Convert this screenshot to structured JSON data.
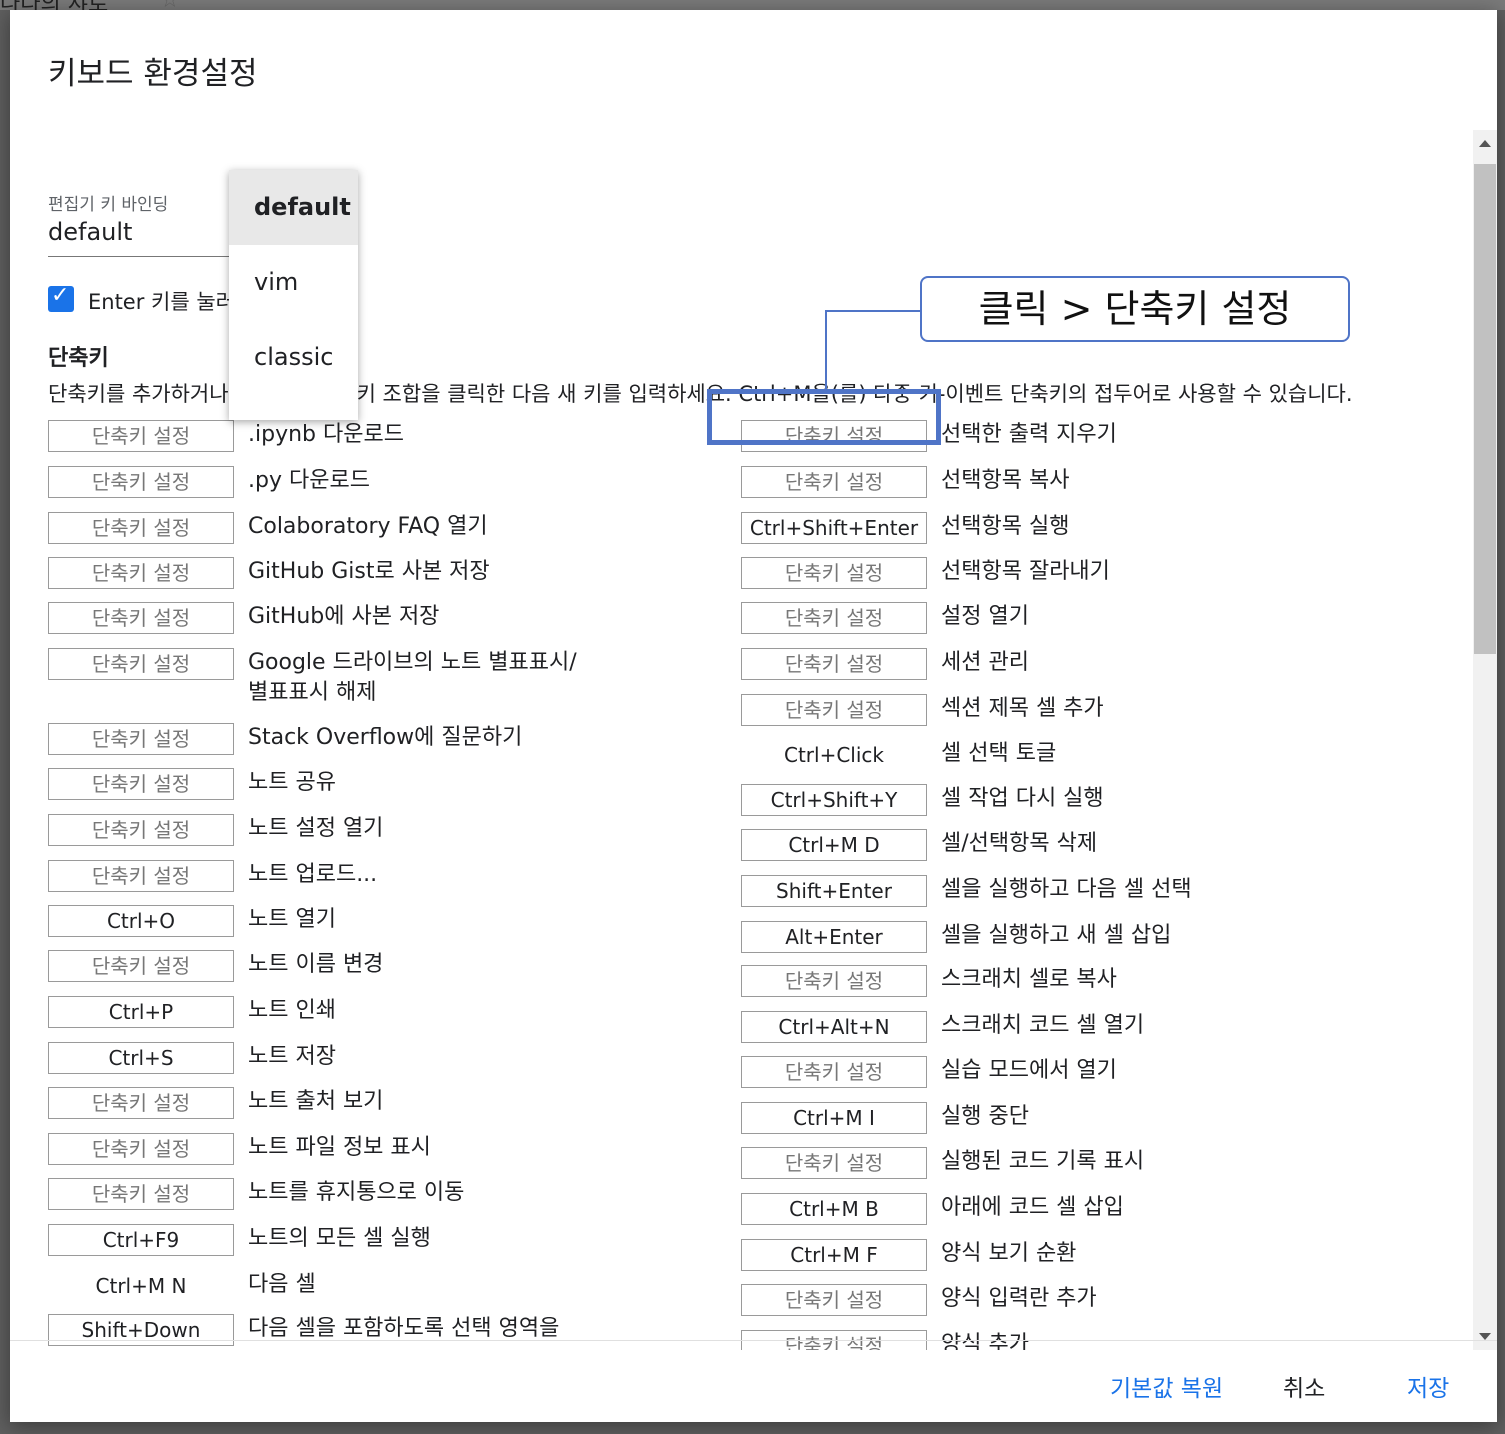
{
  "background": {
    "title": "나다의 샤로",
    "star_icon": "star-icon"
  },
  "dialog": {
    "title": "키보드 환경설정",
    "binding_label": "편집기 키 바인딩",
    "binding_value": "default",
    "binding_options": [
      "default",
      "vim",
      "classic"
    ],
    "enter_checkbox": {
      "checked": true,
      "label": "Enter 키를 눌러"
    },
    "shortcuts_heading": "단축키",
    "shortcuts_desc_prefix": "단축키를 추가하거나",
    "shortcuts_desc_suffix": "키 조합을 클릭한 다음 새 키를 입력하세요. Ctrl+M을(를) 다중 키-이벤트 단축키의 접두어로 사용할 수 있습니다.",
    "left_shortcuts": [
      {
        "key": "단축키 설정",
        "unset": true,
        "label": ".ipynb 다운로드"
      },
      {
        "key": "단축키 설정",
        "unset": true,
        "label": ".py 다운로드"
      },
      {
        "key": "단축키 설정",
        "unset": true,
        "label": "Colaboratory FAQ 열기"
      },
      {
        "key": "단축키 설정",
        "unset": true,
        "label": "GitHub Gist로 사본 저장"
      },
      {
        "key": "단축키 설정",
        "unset": true,
        "label": "GitHub에 사본 저장"
      },
      {
        "key": "단축키 설정",
        "unset": true,
        "label": "Google 드라이브의 노트 별표표시/",
        "label2": "별표표시 해제"
      },
      {
        "key": "단축키 설정",
        "unset": true,
        "label": "Stack Overflow에 질문하기"
      },
      {
        "key": "단축키 설정",
        "unset": true,
        "label": "노트 공유"
      },
      {
        "key": "단축키 설정",
        "unset": true,
        "label": "노트 설정 열기"
      },
      {
        "key": "단축키 설정",
        "unset": true,
        "label": "노트 업로드..."
      },
      {
        "key": "Ctrl+O",
        "unset": false,
        "label": "노트 열기"
      },
      {
        "key": "단축키 설정",
        "unset": true,
        "label": "노트 이름 변경"
      },
      {
        "key": "Ctrl+P",
        "unset": false,
        "label": "노트 인쇄"
      },
      {
        "key": "Ctrl+S",
        "unset": false,
        "label": "노트 저장"
      },
      {
        "key": "단축키 설정",
        "unset": true,
        "label": "노트 출처 보기"
      },
      {
        "key": "단축키 설정",
        "unset": true,
        "label": "노트 파일 정보 표시"
      },
      {
        "key": "단축키 설정",
        "unset": true,
        "label": "노트를 휴지통으로 이동"
      },
      {
        "key": "Ctrl+F9",
        "unset": false,
        "label": "노트의 모든 셀 실행"
      },
      {
        "key": "Ctrl+M N",
        "unset": false,
        "plain": true,
        "label": "다음 셀"
      },
      {
        "key": "Shift+Down",
        "unset": false,
        "label": "다음 셀을 포함하도록 선택 영역을"
      }
    ],
    "right_shortcuts": [
      {
        "key": "단축키 설정",
        "unset": true,
        "label": "선택한 출력 지우기"
      },
      {
        "key": "단축키 설정",
        "unset": true,
        "label": "선택항목 복사"
      },
      {
        "key": "Ctrl+Shift+Enter",
        "unset": false,
        "label": "선택항목 실행"
      },
      {
        "key": "단축키 설정",
        "unset": true,
        "label": "선택항목 잘라내기"
      },
      {
        "key": "단축키 설정",
        "unset": true,
        "label": "설정 열기"
      },
      {
        "key": "단축키 설정",
        "unset": true,
        "label": "세션 관리"
      },
      {
        "key": "단축키 설정",
        "unset": true,
        "label": "섹션 제목 셀 추가"
      },
      {
        "key": "Ctrl+Click",
        "unset": false,
        "plain": true,
        "label": "셀 선택 토글"
      },
      {
        "key": "Ctrl+Shift+Y",
        "unset": false,
        "label": "셀 작업 다시 실행"
      },
      {
        "key": "Ctrl+M D",
        "unset": false,
        "label": "셀/선택항목 삭제"
      },
      {
        "key": "Shift+Enter",
        "unset": false,
        "label": "셀을 실행하고 다음 셀 선택"
      },
      {
        "key": "Alt+Enter",
        "unset": false,
        "label": "셀을 실행하고 새 셀 삽입"
      },
      {
        "key": "단축키 설정",
        "unset": true,
        "label": "스크래치 셀로 복사"
      },
      {
        "key": "Ctrl+Alt+N",
        "unset": false,
        "label": "스크래치 코드 셀 열기"
      },
      {
        "key": "단축키 설정",
        "unset": true,
        "label": "실습 모드에서 열기"
      },
      {
        "key": "Ctrl+M I",
        "unset": false,
        "label": "실행 중단"
      },
      {
        "key": "단축키 설정",
        "unset": true,
        "label": "실행된 코드 기록 표시"
      },
      {
        "key": "Ctrl+M B",
        "unset": false,
        "label": "아래에 코드 셀 삽입"
      },
      {
        "key": "Ctrl+M F",
        "unset": false,
        "label": "양식 보기 순환"
      },
      {
        "key": "단축키 설정",
        "unset": true,
        "label": "양식 입력란 추가"
      },
      {
        "key": "단축키 설정",
        "unset": true,
        "label": "양식 추가"
      }
    ],
    "footer": {
      "reset": "기본값 복원",
      "cancel": "취소",
      "save": "저장"
    }
  },
  "annotation": {
    "callout": "클릭 > 단축키 설정",
    "color": "#4f74c7"
  },
  "colors": {
    "accent": "#1a73e8"
  }
}
